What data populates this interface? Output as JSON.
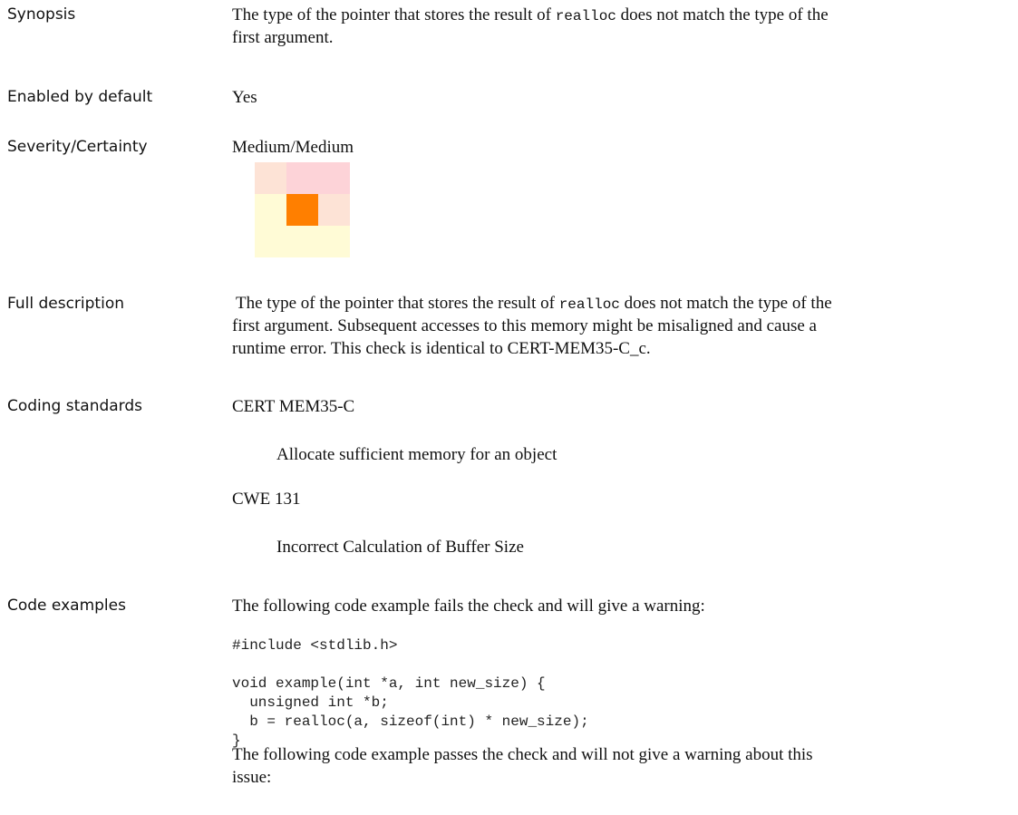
{
  "synopsis": {
    "label": "Synopsis",
    "text_pre": "The type of the pointer that stores the result of ",
    "code": "realloc",
    "text_mid": " does not match the type of the",
    "text_line2": "first argument."
  },
  "enabled": {
    "label": "Enabled by default",
    "value": "Yes"
  },
  "severity": {
    "label": "Severity/Certainty",
    "value": "Medium/Medium",
    "matrix_colors": [
      [
        "#fde3d6",
        "#fdd3d8",
        "#fdd3d8"
      ],
      [
        "#fffbd6",
        "#ff7f00",
        "#fde3d6"
      ],
      [
        "#fffbd6",
        "#fffbd6",
        "#fffbd6"
      ]
    ]
  },
  "full_description": {
    "label": "Full description",
    "line1_pre": "The type of the pointer that stores the result of ",
    "line1_code": "realloc",
    "line1_post": " does not match the type of the",
    "line2": "first argument. Subsequent accesses to this memory might be misaligned and cause a",
    "line3": "runtime error. This check is identical to CERT-MEM35-C_c."
  },
  "coding_standards": {
    "label": "Coding standards",
    "items": [
      {
        "id": "CERT MEM35-C",
        "desc": "Allocate sufficient memory for an object"
      },
      {
        "id": "CWE 131",
        "desc": "Incorrect Calculation of Buffer Size"
      }
    ]
  },
  "code_examples": {
    "label": "Code examples",
    "fail_intro": "The following code example fails the check and will give a warning:",
    "fail_code": "#include <stdlib.h>\n\nvoid example(int *a, int new_size) {\n  unsigned int *b;\n  b = realloc(a, sizeof(int) * new_size);\n}",
    "pass_intro_line1": "The following code example passes the check and will not give a warning about this",
    "pass_intro_line2": "issue:"
  }
}
